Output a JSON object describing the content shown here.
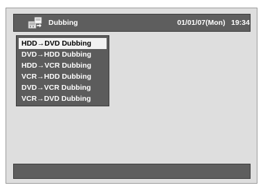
{
  "header": {
    "icon": "dubbing-icon",
    "title": "Dubbing",
    "date": "01/01/07(Mon)",
    "time": "19:34"
  },
  "menu": {
    "selected_index": 0,
    "items": [
      {
        "label": "HDD→DVD Dubbing"
      },
      {
        "label": "DVD→HDD Dubbing"
      },
      {
        "label": "HDD→VCR Dubbing"
      },
      {
        "label": "VCR→HDD Dubbing"
      },
      {
        "label": "DVD→VCR Dubbing"
      },
      {
        "label": "VCR→DVD Dubbing"
      }
    ]
  },
  "colors": {
    "panel": "#5e5e5e",
    "background": "#dedede",
    "highlight": "#f2f2f2"
  }
}
